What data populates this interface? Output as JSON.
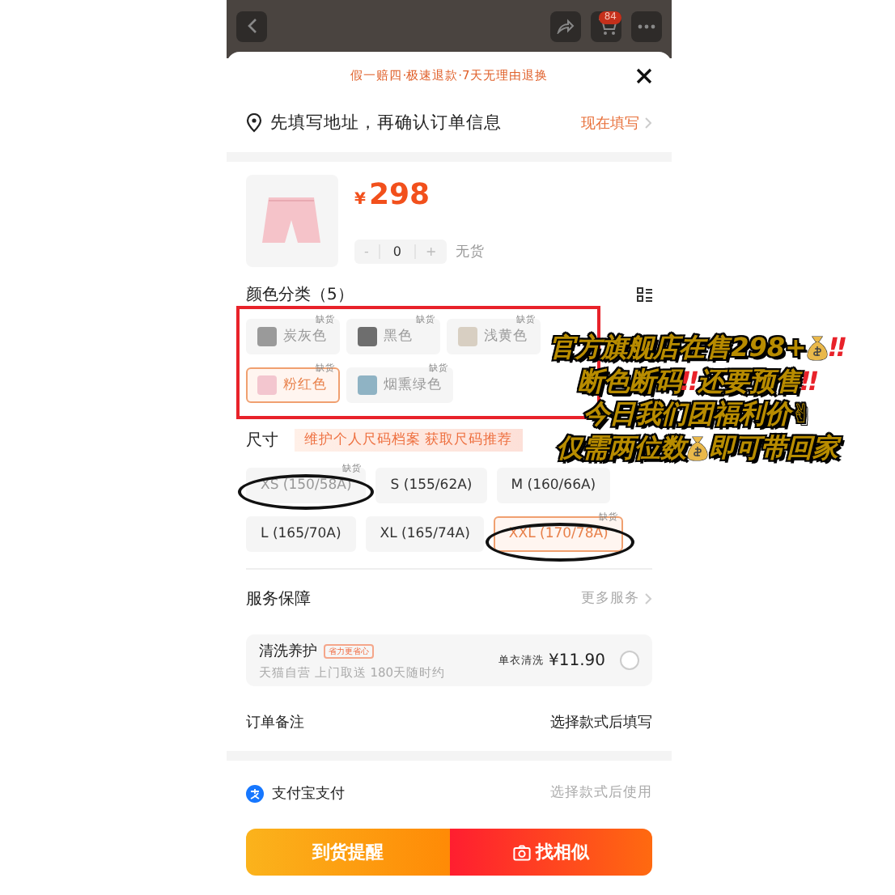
{
  "top_bar": {
    "cart_badge": "84"
  },
  "promo": "假一赔四·极速退款·7天无理由退换",
  "address": {
    "text": "先填写地址，再确认订单信息",
    "action": "现在填写"
  },
  "product": {
    "currency": "¥",
    "price": "298",
    "decrement": "-",
    "quantity": "0",
    "increment": "+",
    "stock": "无货"
  },
  "colors": {
    "title": "颜色分类（5）",
    "items": [
      {
        "label": "炭灰色",
        "tag": "缺货",
        "selected": false,
        "color": "#9a9a9a"
      },
      {
        "label": "黑色",
        "tag": "缺货",
        "selected": false,
        "color": "#6e6e6e"
      },
      {
        "label": "浅黄色",
        "tag": "缺货",
        "selected": false,
        "color": "#d8cfc2"
      },
      {
        "label": "粉红色",
        "tag": "缺货",
        "selected": true,
        "color": "#f3c6cf"
      },
      {
        "label": "烟熏绿色",
        "tag": "缺货",
        "selected": false,
        "color": "#8fb3c4"
      }
    ]
  },
  "sizes": {
    "title": "尺寸",
    "banner": "维护个人尺码档案 获取尺码推荐",
    "items": [
      {
        "label": "XS (150/58A)",
        "tag": "缺货",
        "selected": false,
        "disabled": true
      },
      {
        "label": "S (155/62A)",
        "selected": false,
        "disabled": false
      },
      {
        "label": "M (160/66A)",
        "selected": false,
        "disabled": false
      },
      {
        "label": "L (165/70A)",
        "selected": false,
        "disabled": false
      },
      {
        "label": "XL (165/74A)",
        "selected": false,
        "disabled": false
      },
      {
        "label": "XXL (170/78A)",
        "tag": "缺货",
        "selected": true,
        "disabled": true
      }
    ]
  },
  "service": {
    "title": "服务保障",
    "more": "更多服务",
    "option": {
      "name": "清洗养护",
      "badge": "省力更省心",
      "desc": "天猫自营 上门取送 180天随时约",
      "price_label": "单衣清洗",
      "price": "¥11.90",
      "checked": false
    }
  },
  "note": {
    "label": "订单备注",
    "value": "选择款式后填写"
  },
  "payment": {
    "label": "支付宝支付",
    "value": "选择款式后使用"
  },
  "buttons": [
    {
      "label": "到货提醒",
      "kind": "remind"
    },
    {
      "label": "找相似",
      "kind": "similar"
    }
  ],
  "caption": [
    [
      {
        "kind": "text",
        "text": "官方旗舰店在售298+"
      },
      {
        "kind": "moneybag"
      },
      {
        "kind": "alert",
        "text": "‼"
      }
    ],
    [
      {
        "kind": "text",
        "text": "断色断码"
      },
      {
        "kind": "alert",
        "text": "‼"
      },
      {
        "kind": "text",
        "text": "还要预售"
      },
      {
        "kind": "alert",
        "text": "‼"
      }
    ],
    [
      {
        "kind": "text",
        "text": "今日我们团福利价✌"
      }
    ],
    [
      {
        "kind": "text",
        "text": "仅需两位数"
      },
      {
        "kind": "moneybag"
      },
      {
        "kind": "text",
        "text": "即可带回家"
      }
    ]
  ]
}
